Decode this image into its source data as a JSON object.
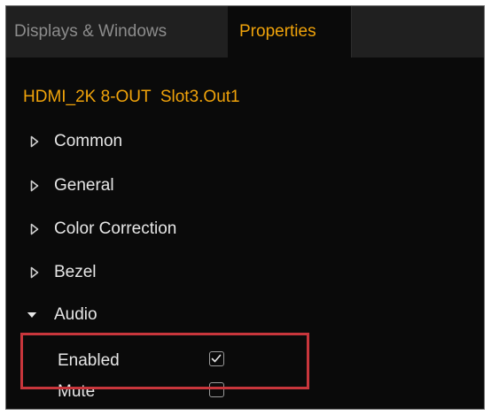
{
  "tabs": {
    "displays_windows": "Displays & Windows",
    "properties": "Properties"
  },
  "device": {
    "title": "HDMI_2K 8-OUT  Slot3.Out1"
  },
  "groups": [
    {
      "label": "Common",
      "expanded": false
    },
    {
      "label": "General",
      "expanded": false
    },
    {
      "label": "Color Correction",
      "expanded": false
    },
    {
      "label": "Bezel",
      "expanded": false
    },
    {
      "label": "Audio",
      "expanded": true
    }
  ],
  "audio_properties": [
    {
      "label": "Enabled",
      "checked": true
    },
    {
      "label": "Mute",
      "checked": false
    }
  ],
  "colors": {
    "accent": "#f0a30a",
    "highlight": "#c8363c",
    "panel_bg": "#0a0a0a",
    "tab_inactive_bg": "#202020"
  },
  "icons": {
    "collapsed": "triangle-right-outline-icon",
    "expanded": "triangle-down-filled-icon",
    "checkbox_checked": "checkmark-icon"
  }
}
